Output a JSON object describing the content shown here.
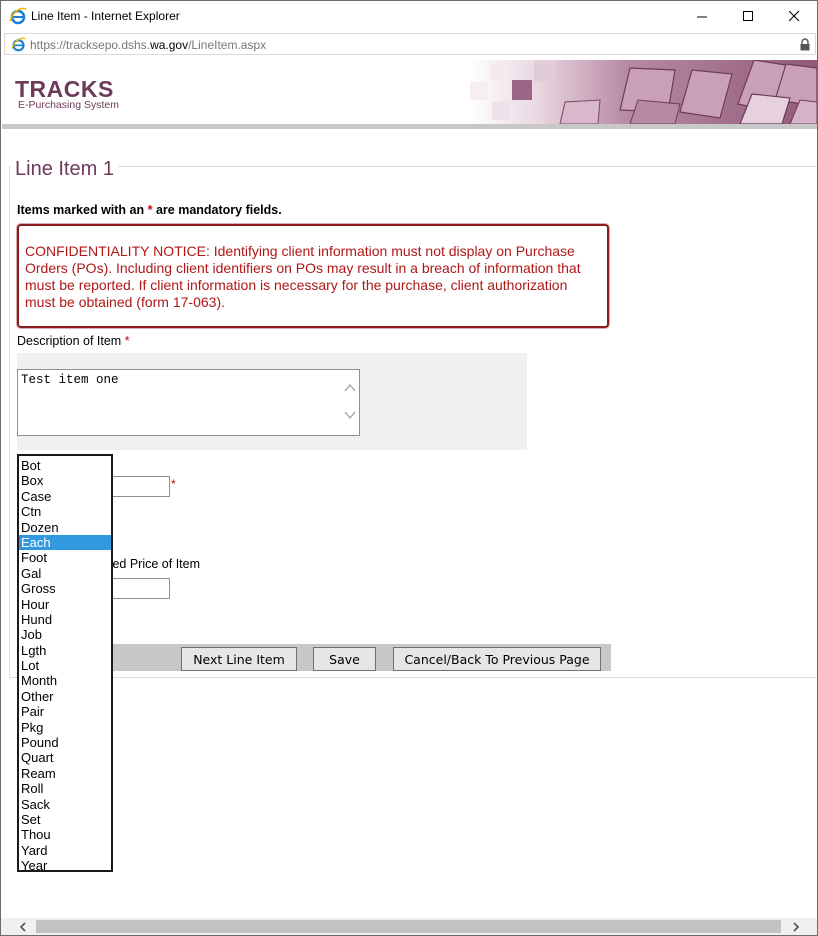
{
  "window": {
    "title": "Line Item - Internet Explorer",
    "url_prefix": "https://tracksepo.dshs.",
    "url_domain": "wa.gov",
    "url_path": "/LineItem.aspx"
  },
  "banner": {
    "logo_title": "TRACKS",
    "logo_subtitle": "E-Purchasing System"
  },
  "page": {
    "legend": "Line Item 1",
    "mandatory_prefix": "Items marked with an ",
    "mandatory_star": "*",
    "mandatory_suffix": " are mandatory fields.",
    "notice": "CONFIDENTIALITY NOTICE: Identifying client information must not display on Purchase Orders (POs). Including client identifiers on POs may result in a breach of information that must be reported. If client information is necessary for the purchase, client authorization must be obtained (form 17-063).",
    "description_label": "Description of Item",
    "description_star": "*",
    "description_value": "Test item one",
    "quantity_star": "*",
    "price_label_partial": "ted Price of Item"
  },
  "buttons": {
    "next": "Next Line Item",
    "save": "Save",
    "cancel": "Cancel/Back To Previous Page"
  },
  "unit_dropdown": {
    "selected": "Each",
    "options": [
      "Bot",
      "Box",
      "Case",
      "Ctn",
      "Dozen",
      "Each",
      "Foot",
      "Gal",
      "Gross",
      "Hour",
      "Hund",
      "Job",
      "Lgth",
      "Lot",
      "Month",
      "Other",
      "Pair",
      "Pkg",
      "Pound",
      "Quart",
      "Ream",
      "Roll",
      "Sack",
      "Set",
      "Thou",
      "Yard",
      "Year"
    ]
  },
  "colors": {
    "brand": "#6e3a5a",
    "notice_text": "#b01818",
    "required_star": "#cc0000",
    "selection": "#3298e0"
  },
  "icons": [
    "ie-logo-icon",
    "minimize-icon",
    "maximize-icon",
    "close-icon",
    "lock-icon",
    "scroll-up-icon",
    "scroll-down-icon",
    "scroll-left-icon",
    "scroll-right-icon"
  ]
}
